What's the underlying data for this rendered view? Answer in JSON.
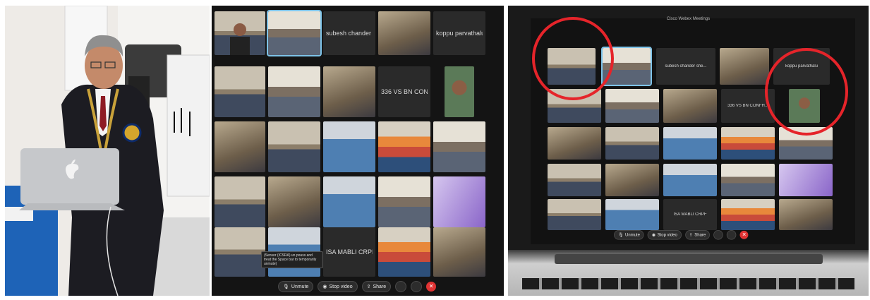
{
  "meeting": {
    "window_title": "Cisco Webex Meetings",
    "participants": [
      "subesh chander she...",
      "koppu parvathalu",
      "336 VS BN CONFH...",
      "ISA MABLI CRPF"
    ],
    "toast": "(Sensor (ICSRA) un pouss and treat the Space bar to temporarily unmute)",
    "toolbar": {
      "unmute": "Unmute",
      "stop_video": "Stop video",
      "share": "Share"
    }
  },
  "logos": {
    "laptop": "apple-logo"
  },
  "colors": {
    "end_call": "#e03333",
    "annotation": "#e5242a",
    "active_tile": "#7ec3e8"
  }
}
